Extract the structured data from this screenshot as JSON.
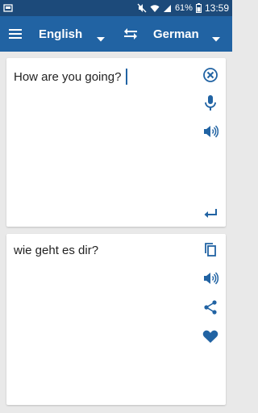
{
  "status_bar": {
    "battery_percent": "61%",
    "time": "13:59"
  },
  "header": {
    "source_language": "English",
    "target_language": "German"
  },
  "input": {
    "text": "How are you going?"
  },
  "output": {
    "text": "wie geht es dir?"
  },
  "colors": {
    "status_bar": "#1c4a7a",
    "app_bar": "#2163a3",
    "icon": "#2163a3",
    "background": "#e9e9e9"
  },
  "icons": {
    "input_panel": [
      "clear-icon",
      "microphone-icon",
      "speaker-icon",
      "enter-icon"
    ],
    "output_panel": [
      "copy-icon",
      "speaker-icon",
      "share-icon",
      "favorite-icon"
    ]
  }
}
